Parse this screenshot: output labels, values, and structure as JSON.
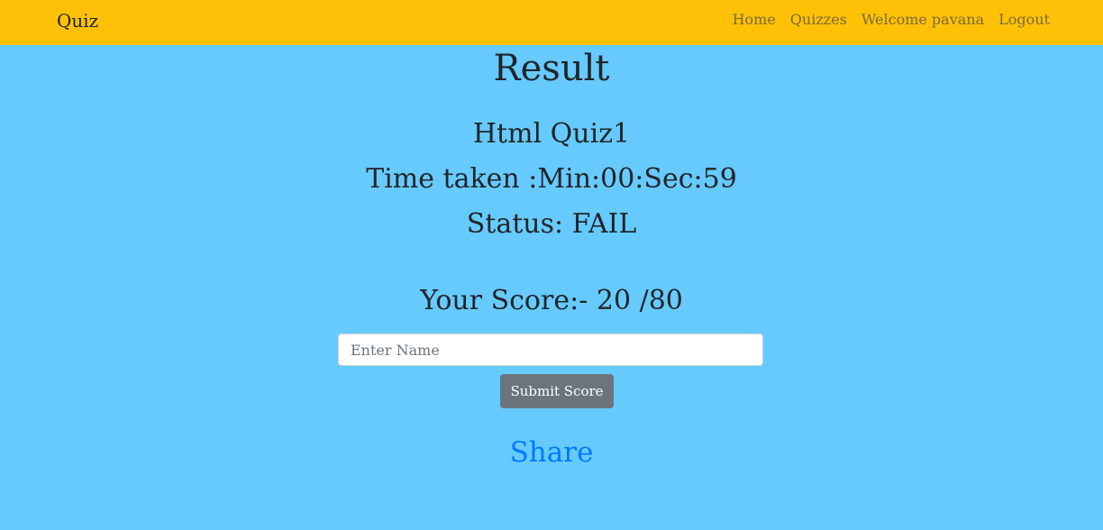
{
  "nav": {
    "brand": "Quiz",
    "items": [
      {
        "label": "Home"
      },
      {
        "label": "Quizzes"
      },
      {
        "label": "Welcome pavana"
      },
      {
        "label": "Logout"
      }
    ]
  },
  "result": {
    "title": "Result",
    "quiz_name": "Html Quiz1",
    "time_taken": "Time taken :Min:00:Sec:59",
    "status": "Status: FAIL",
    "score": "Your Score:- 20 /80"
  },
  "form": {
    "name_placeholder": "Enter Name",
    "name_value": "",
    "submit_label": "Submit Score"
  },
  "share": {
    "label": "Share"
  },
  "colors": {
    "navbar": "#ffc107",
    "background": "#66caff",
    "button": "#6c757d",
    "link": "#007bff"
  }
}
